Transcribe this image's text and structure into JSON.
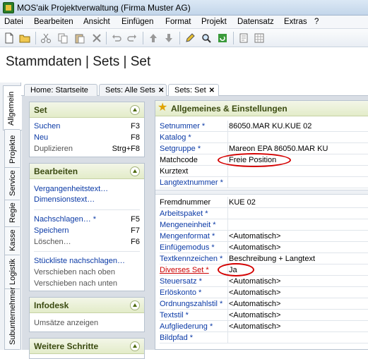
{
  "window": {
    "title": "MOS'aik Projektverwaltung (Firma Muster AG)"
  },
  "menu": [
    "Datei",
    "Bearbeiten",
    "Ansicht",
    "Einfügen",
    "Format",
    "Projekt",
    "Datensatz",
    "Extras",
    "?"
  ],
  "toolbar": {
    "icons": [
      "new-icon",
      "open-icon",
      "cut-icon",
      "copy-icon",
      "paste-icon",
      "delete-icon",
      "undo-icon",
      "redo-icon",
      "arrow-up-icon",
      "arrow-down-icon",
      "edit-icon",
      "search-icon",
      "refresh-icon",
      "print-preview-icon",
      "grid-icon"
    ]
  },
  "page_title": "Stammdaten | Sets | Set",
  "side_tabs": [
    "Allgemein",
    "Projekte",
    "Service",
    "Regie",
    "Kasse",
    "Logistik",
    "Subunternehmer"
  ],
  "doc_tabs": [
    {
      "label": "Home: Startseite",
      "closable": false
    },
    {
      "label": "Sets: Alle Sets",
      "closable": true
    },
    {
      "label": "Sets: Set",
      "closable": true,
      "active": true
    }
  ],
  "panels": {
    "set": {
      "title": "Set",
      "items": [
        {
          "label": "Suchen",
          "shortcut": "F3"
        },
        {
          "label": "Neu",
          "shortcut": "F8"
        },
        {
          "label": "Duplizieren",
          "shortcut": "Strg+F8"
        }
      ]
    },
    "bearbeiten": {
      "title": "Bearbeiten",
      "items": [
        {
          "label": "Vergangenheitstext…",
          "shortcut": ""
        },
        {
          "label": "Dimensionstext…",
          "shortcut": ""
        },
        {
          "label": "Nachschlagen… *",
          "shortcut": "F5"
        },
        {
          "label": "Speichern",
          "shortcut": "F7"
        },
        {
          "label": "Löschen…",
          "shortcut": "F6"
        },
        {
          "label": "Stückliste nachschlagen…",
          "shortcut": ""
        },
        {
          "label": "Verschieben nach oben",
          "shortcut": ""
        },
        {
          "label": "Verschieben nach unten",
          "shortcut": ""
        }
      ]
    },
    "infodesk": {
      "title": "Infodesk",
      "items": [
        {
          "label": "Umsätze anzeigen"
        }
      ]
    },
    "weitere": {
      "title": "Weitere Schritte"
    }
  },
  "details": {
    "title": "Allgemeines & Einstellungen",
    "group1": [
      {
        "label": "Setnummer *",
        "value": "86050.MAR KU.KUE 02"
      },
      {
        "label": "Katalog *",
        "value": ""
      },
      {
        "label": "Setgruppe *",
        "value": "Mareon EPA 86050.MAR KU"
      },
      {
        "label": "Matchcode",
        "value": "Freie Position"
      },
      {
        "label": "Kurztext",
        "value": ""
      },
      {
        "label": "Langtextnummer *",
        "value": ""
      }
    ],
    "group2": [
      {
        "label": "Fremdnummer",
        "value": "KUE 02"
      },
      {
        "label": "Arbeitspaket *",
        "value": ""
      },
      {
        "label": "Mengeneinheit *",
        "value": ""
      },
      {
        "label": "Mengenformat *",
        "value": "<Automatisch>"
      },
      {
        "label": "Einfügemodus *",
        "value": "<Automatisch>"
      },
      {
        "label": "Textkennzeichen *",
        "value": "Beschreibung + Langtext"
      },
      {
        "label": "Diverses Set *",
        "value": "Ja"
      },
      {
        "label": "Steuersatz *",
        "value": "<Automatisch>"
      },
      {
        "label": "Erlöskonto *",
        "value": "<Automatisch>"
      },
      {
        "label": "Ordnungszahlstil *",
        "value": "<Automatisch>"
      },
      {
        "label": "Textstil *",
        "value": "<Automatisch>"
      },
      {
        "label": "Aufgliederung *",
        "value": "<Automatisch>"
      },
      {
        "label": "Bildpfad *",
        "value": ""
      }
    ]
  }
}
